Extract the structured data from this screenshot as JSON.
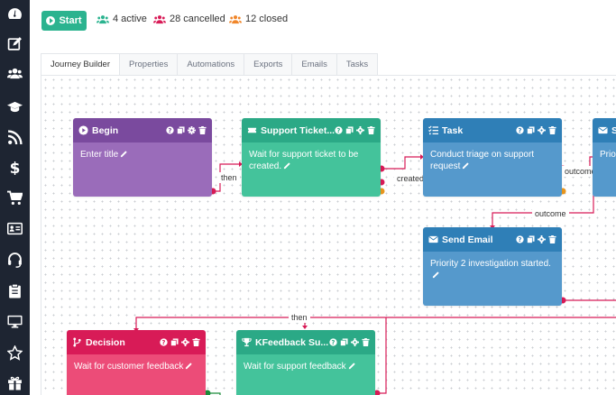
{
  "sidebar": {
    "items": [
      {
        "icon": "dashboard-icon"
      },
      {
        "icon": "edit-icon"
      },
      {
        "icon": "users-icon"
      },
      {
        "icon": "graduation-cap-icon"
      },
      {
        "icon": "rss-icon"
      },
      {
        "icon": "dollar-icon"
      },
      {
        "icon": "cart-icon"
      },
      {
        "icon": "id-card-icon"
      },
      {
        "icon": "headset-icon"
      },
      {
        "icon": "clipboard-icon"
      },
      {
        "icon": "desktop-icon"
      },
      {
        "icon": "star-icon"
      },
      {
        "icon": "gift-icon"
      }
    ]
  },
  "toolbar": {
    "start_label": "Start",
    "stats": [
      {
        "label": "4 active",
        "color": "#2bb38f"
      },
      {
        "label": "28 cancelled",
        "color": "#d81b57"
      },
      {
        "label": "12 closed",
        "color": "#f0862a"
      }
    ]
  },
  "tabs": [
    {
      "label": "Journey Builder",
      "active": true
    },
    {
      "label": "Properties",
      "active": false
    },
    {
      "label": "Automations",
      "active": false
    },
    {
      "label": "Exports",
      "active": false
    },
    {
      "label": "Emails",
      "active": false
    },
    {
      "label": "Tasks",
      "active": false
    }
  ],
  "nodes": {
    "begin": {
      "title": "Begin",
      "body": "Enter title",
      "color": "#7a4a9e",
      "icon": "play-circle-icon"
    },
    "support_ticket": {
      "title": "Support Ticket...",
      "body": "Wait for support ticket to be created.",
      "color": "#2ba986",
      "icon": "ticket-icon"
    },
    "task": {
      "title": "Task",
      "body": "Conduct triage on support request",
      "color": "#2f7fb7",
      "icon": "tasks-icon"
    },
    "send_email_partial": {
      "title": "S",
      "body": "Priori",
      "color": "#2f7fb7",
      "icon": "envelope-icon"
    },
    "send_email": {
      "title": "Send Email",
      "body": "Priority 2 investigation started.",
      "color": "#2f7fb7",
      "icon": "envelope-icon"
    },
    "decision": {
      "title": "Decision",
      "body": "Wait for customer feedback",
      "color": "#d81b57",
      "icon": "branch-icon"
    },
    "feedback": {
      "title": "KFeedback Su...",
      "body": "Wait for support feedback",
      "color": "#2ba986",
      "icon": "trophy-icon"
    }
  },
  "edges": {
    "then_1": "then",
    "created": "created",
    "outcome_1": "outcome",
    "outcome_2": "outcome",
    "then_2": "then"
  }
}
